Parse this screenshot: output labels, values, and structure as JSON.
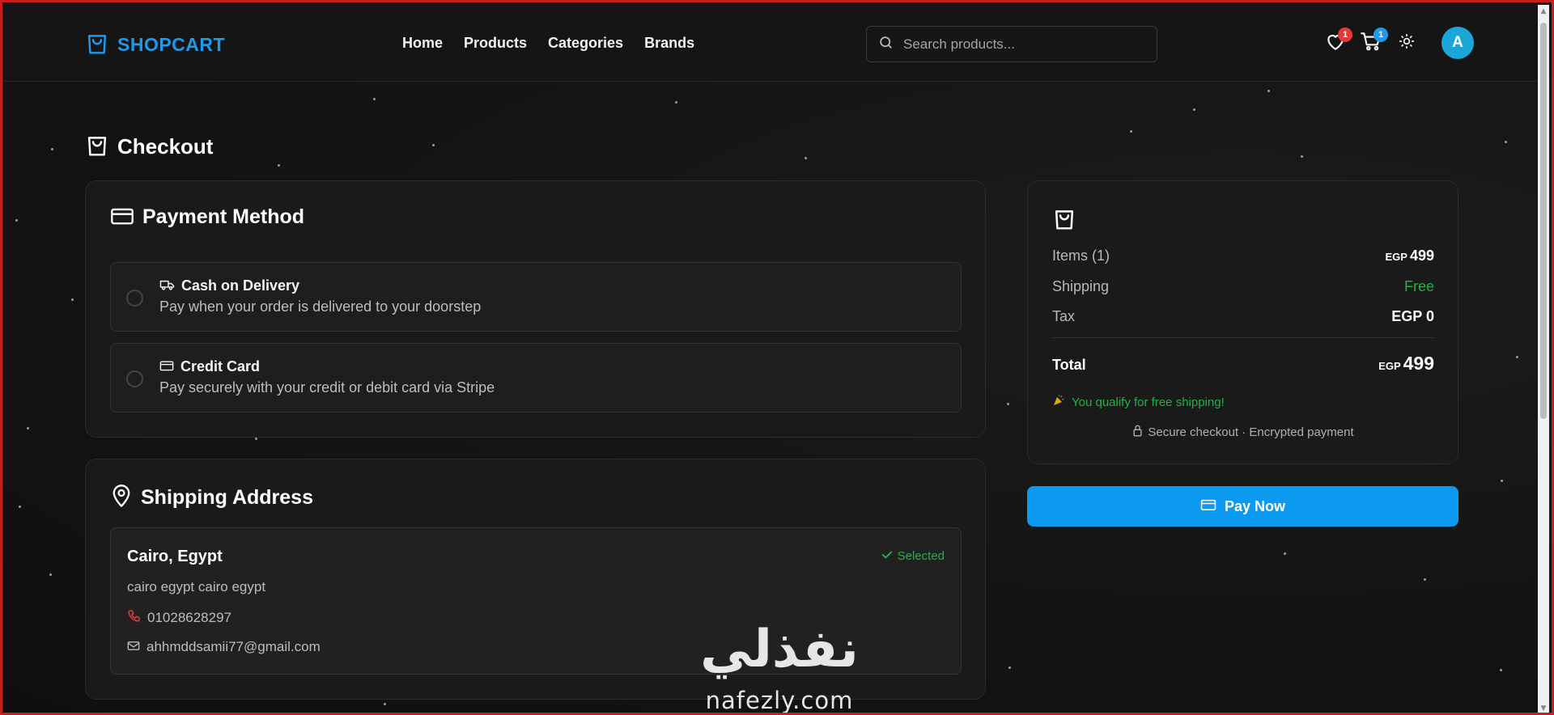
{
  "colors": {
    "brand": "#1e9ae8",
    "pay_button": "#0c9af0",
    "success": "#22b14c",
    "wishlist_badge": "#e5383b",
    "cart_badge": "#1e9ae8",
    "avatar": "#1aa7d8"
  },
  "navbar": {
    "logo_text": "SHOPCART",
    "links": [
      "Home",
      "Products",
      "Categories",
      "Brands"
    ],
    "search_placeholder": "Search products...",
    "wishlist_count": "1",
    "cart_count": "1",
    "avatar_initial": "A",
    "icons": [
      "shopping-bag-icon",
      "search-icon",
      "heart-icon",
      "cart-icon",
      "sun-icon"
    ]
  },
  "page": {
    "title": "Checkout"
  },
  "payment": {
    "title": "Payment Method",
    "options": [
      {
        "title": "Cash on Delivery",
        "description": "Pay when your order is delivered to your doorstep",
        "icon": "truck-icon"
      },
      {
        "title": "Credit Card",
        "description": "Pay securely with your credit or debit card via Stripe",
        "icon": "credit-card-icon"
      }
    ]
  },
  "shipping": {
    "title": "Shipping Address",
    "city": "Cairo, Egypt",
    "status": "Selected",
    "details": "cairo egypt cairo egypt",
    "phone": "01028628297",
    "email": "ahhmddsamii77@gmail.com"
  },
  "summary": {
    "items_label": "Items (1)",
    "items_currency": "EGP",
    "items_value": "499",
    "shipping_label": "Shipping",
    "shipping_value": "Free",
    "tax_label": "Tax",
    "tax_value": "EGP 0",
    "total_label": "Total",
    "total_currency": "EGP",
    "total_value": "499",
    "free_shipping_note": "You qualify for free shipping!",
    "secure_note": "Secure checkout · Encrypted payment"
  },
  "pay_button": {
    "label": "Pay Now"
  },
  "watermark": {
    "arabic": "نفذلي",
    "latin": "nafezly.com"
  }
}
